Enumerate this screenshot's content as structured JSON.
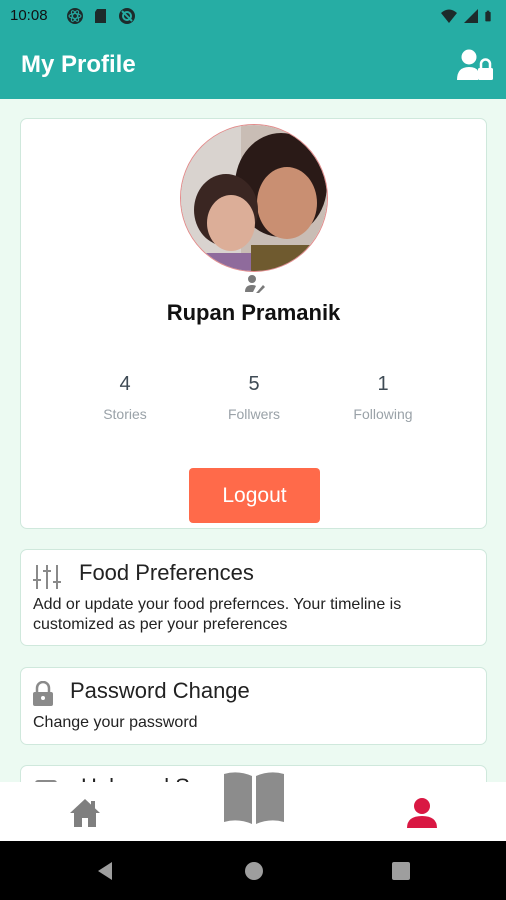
{
  "status_bar": {
    "time": "10:08",
    "icons_left": [
      "react-icon",
      "sd-card-icon",
      "at-sign-icon"
    ],
    "icons_right": [
      "wifi-icon",
      "cell-signal-icon",
      "battery-icon"
    ]
  },
  "app_bar": {
    "title": "My Profile",
    "action_icon": "user-lock-icon"
  },
  "profile": {
    "name": "Rupan Pramanik",
    "stats": [
      {
        "value": "4",
        "label": "Stories"
      },
      {
        "value": "5",
        "label": "Follwers"
      },
      {
        "value": "1",
        "label": "Following"
      }
    ],
    "logout_label": "Logout"
  },
  "settings": [
    {
      "icon": "sliders-icon",
      "title": "Food Preferences",
      "description": "Add or update your food prefernces. Your timeline is customized as per your preferences"
    },
    {
      "icon": "lock-icon",
      "title": "Password Change",
      "description": "Change your password"
    },
    {
      "icon": "help-icon",
      "title": "Help and Support",
      "description": ""
    }
  ],
  "bottom_nav": {
    "items": [
      "home-icon",
      "book-icon",
      "profile-icon"
    ],
    "active": "profile-icon"
  },
  "colors": {
    "primary": "#26ada4",
    "background": "#ecfaf2",
    "logout": "#ff6a4a",
    "active_nav": "#d91843",
    "inactive_nav": "#7f7f7f"
  }
}
